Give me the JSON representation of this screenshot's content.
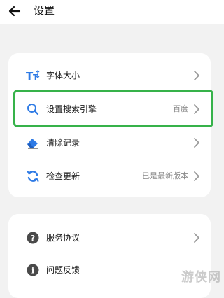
{
  "header": {
    "title": "设置"
  },
  "group1": {
    "items": [
      {
        "label": "字体大小",
        "value": "",
        "icon": "text-size-icon"
      },
      {
        "label": "设置搜索引擎",
        "value": "百度",
        "icon": "search-icon"
      },
      {
        "label": "清除记录",
        "value": "",
        "icon": "eraser-icon"
      },
      {
        "label": "检查更新",
        "value": "已是最新版本",
        "icon": "refresh-icon"
      }
    ]
  },
  "group2": {
    "items": [
      {
        "label": "服务协议",
        "value": "",
        "icon": "question-icon"
      },
      {
        "label": "问题反馈",
        "value": "",
        "icon": "info-icon"
      }
    ]
  },
  "colors": {
    "accent_blue": "#2f7be5",
    "highlight_green": "#36b24a",
    "icon_gray": "#4a4a4a"
  },
  "watermark": "游侠网"
}
